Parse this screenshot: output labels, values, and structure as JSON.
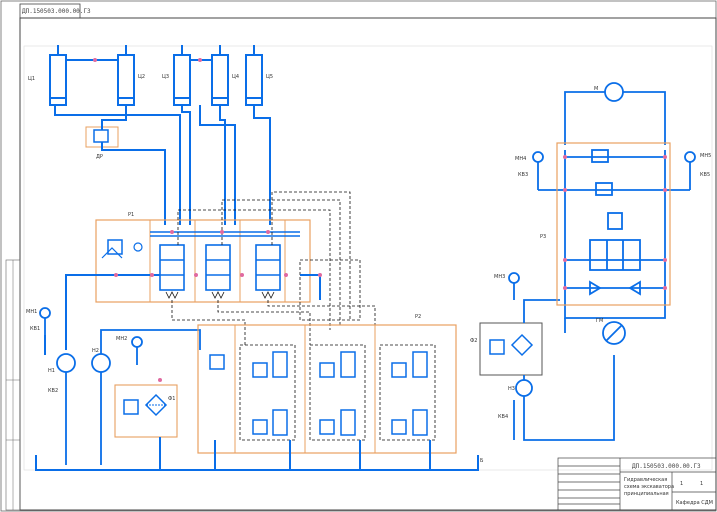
{
  "drawing": {
    "stamp_code": "ДП.150503.000.00.Г3",
    "title_code": "ДП.150503.000.00.Г3",
    "colors": {
      "pipe": "#0a6ee8",
      "frame": "#555555",
      "block": "#e8a060",
      "joint": "#e06aa0",
      "pilot": "#111111"
    }
  },
  "labels": {
    "c1": "Ц1",
    "c2": "Ц2",
    "c3": "Ц3",
    "c4": "Ц4",
    "c5": "Ц5",
    "dr1": "ДР",
    "p1": "Р1",
    "pr": "Р2",
    "mn1": "МН1",
    "mn2": "МН2",
    "mn3": "МН3",
    "mn4": "МН4",
    "mn5": "МН5",
    "kv1": "КВ1",
    "kv2": "КВ2",
    "kv3": "КВ3",
    "kv4": "КВ4",
    "kv5": "КВ5",
    "n1": "Н1",
    "n2": "Н2",
    "n3": "Н3",
    "f1": "Ф1",
    "f2": "Ф2",
    "m": "М",
    "mg": "ГМ",
    "p3": "Р3",
    "b": "Б"
  },
  "title_block": {
    "line1": "Гидравлическая",
    "line2": "схема экскаватора",
    "line3": "принципиальная",
    "sheet": "1",
    "sheets": "1",
    "org": "Кафедра СДМ"
  }
}
